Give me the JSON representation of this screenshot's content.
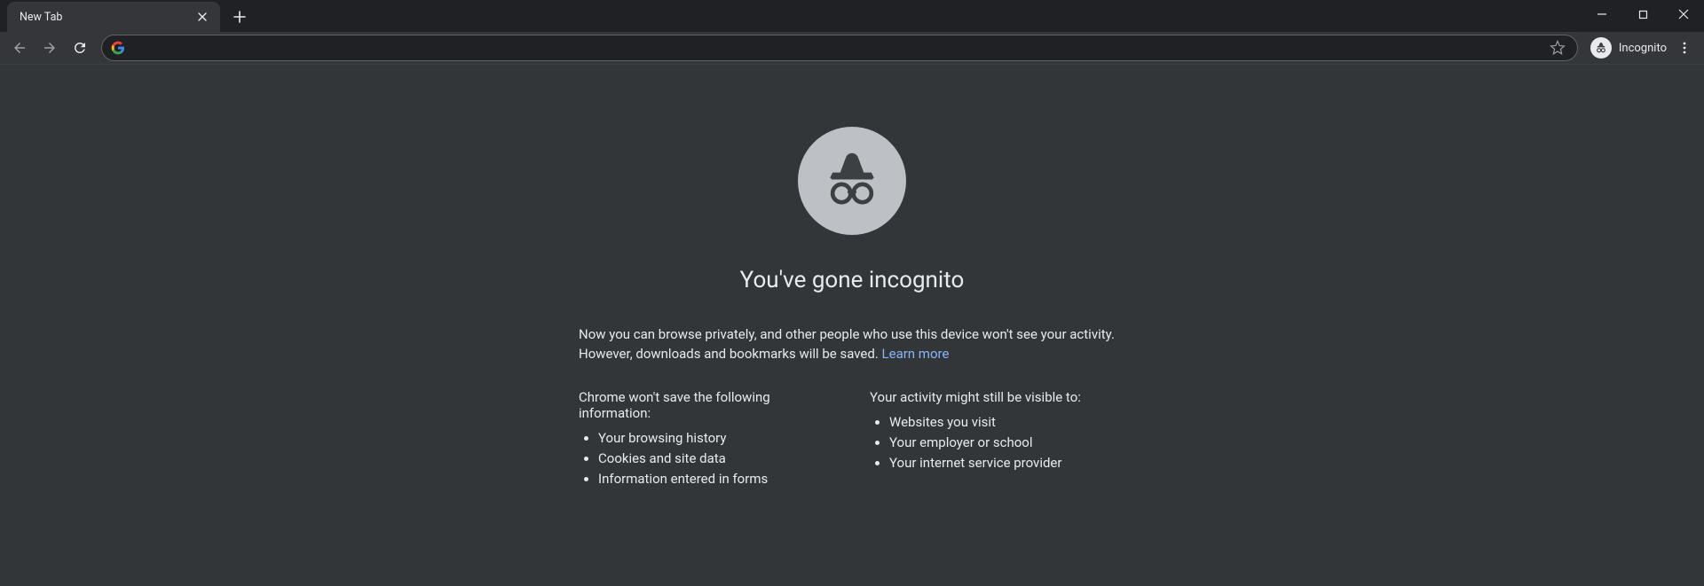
{
  "tab": {
    "title": "New Tab"
  },
  "toolbar": {
    "incognito_label": "Incognito",
    "address_value": ""
  },
  "page": {
    "heading": "You've gone incognito",
    "lead_a": "Now you can browse privately, and other people who use this device won't see your activity. However, downloads and bookmarks will be saved. ",
    "learn_more": "Learn more",
    "col1_title": "Chrome won't save the following information:",
    "col1_items": [
      "Your browsing history",
      "Cookies and site data",
      "Information entered in forms"
    ],
    "col2_title": "Your activity might still be visible to:",
    "col2_items": [
      "Websites you visit",
      "Your employer or school",
      "Your internet service provider"
    ]
  }
}
